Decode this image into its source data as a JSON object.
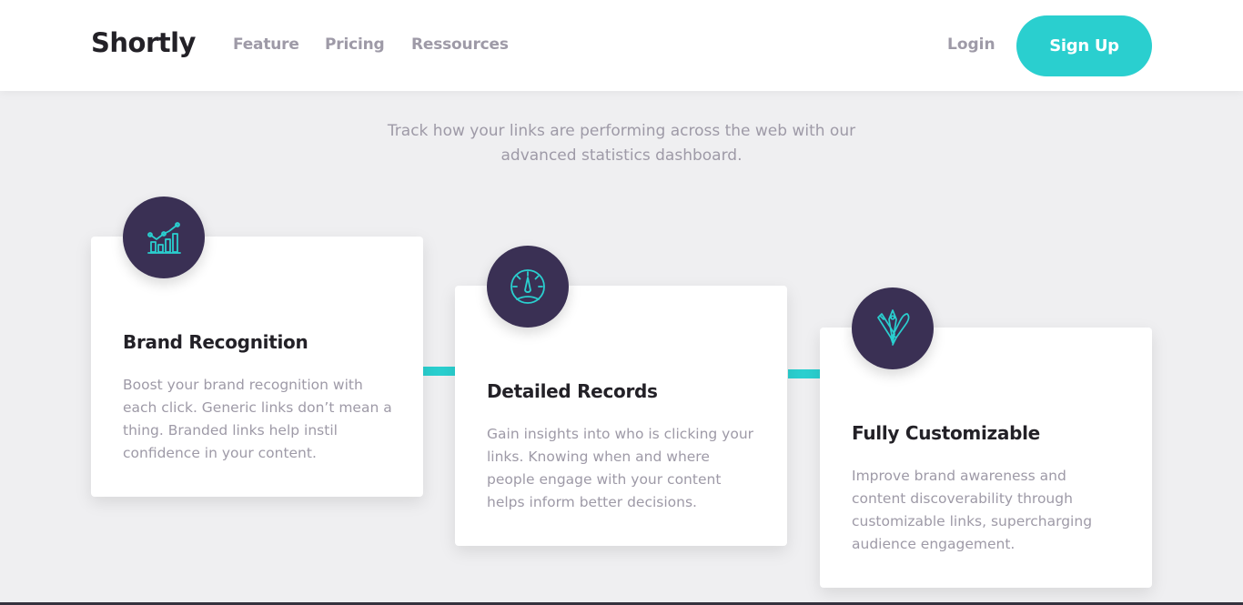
{
  "header": {
    "logo": "Shortly",
    "nav": [
      "Feature",
      "Pricing",
      "Ressources"
    ],
    "login_label": "Login",
    "signup_label": "Sign Up"
  },
  "stats": {
    "subtitle": "Track how your links are performing across the web with our advanced statistics dashboard."
  },
  "cards": [
    {
      "icon": "chart-icon",
      "title": "Brand Recognition",
      "text": "Boost your brand recognition with each click. Generic links don’t mean a thing. Branded links help instil confidence in your content."
    },
    {
      "icon": "gauge-icon",
      "title": "Detailed Records",
      "text": "Gain insights into who is clicking your links. Knowing when and where people engage with your content helps inform better decisions."
    },
    {
      "icon": "pens-icon",
      "title": "Fully Customizable",
      "text": "Improve brand awareness and content discoverability through customizable links, supercharging audience engagement."
    }
  ],
  "colors": {
    "accent": "#2acfcf",
    "dark_violet": "#3a3054",
    "gray": "#9e9aa7",
    "very_dark": "#232127",
    "background": "#efeff1"
  }
}
